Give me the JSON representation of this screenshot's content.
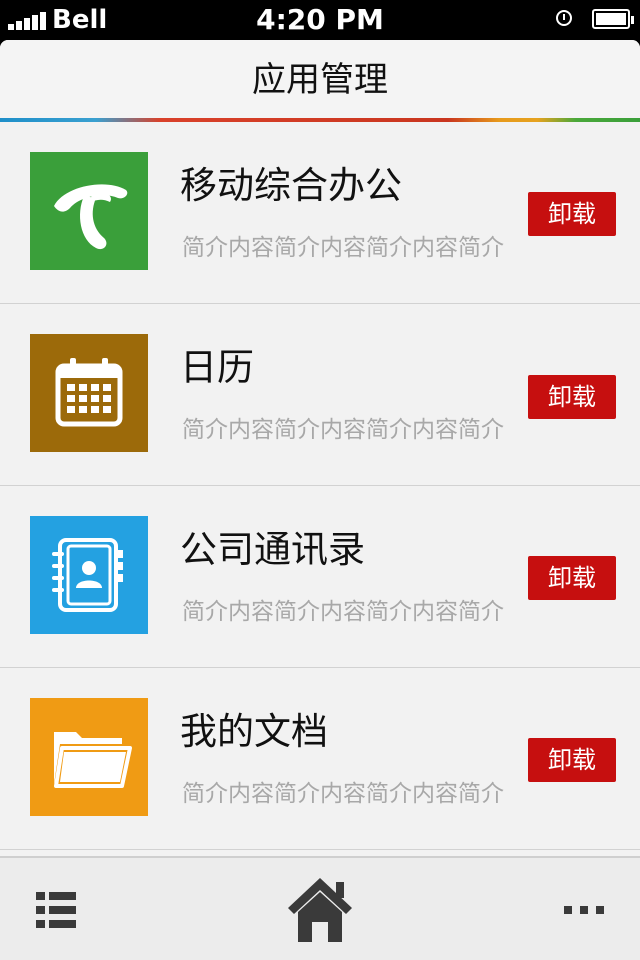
{
  "status_bar": {
    "carrier": "Bell",
    "time": "4:20 PM",
    "icons": [
      "signal-icon",
      "alarm-icon",
      "battery-icon"
    ]
  },
  "header": {
    "title": "应用管理"
  },
  "apps": [
    {
      "name": "移动综合办公",
      "description": "简介内容简介内容简介内容简介",
      "button_label": "卸载",
      "icon": "telecom-logo-icon",
      "icon_color": "#3a9f3a"
    },
    {
      "name": "日历",
      "description": "简介内容简介内容简介内容简介",
      "button_label": "卸载",
      "icon": "calendar-icon",
      "icon_color": "#9c6a0a"
    },
    {
      "name": "公司通讯录",
      "description": "简介内容简介内容简介内容简介",
      "button_label": "卸载",
      "icon": "address-book-icon",
      "icon_color": "#24a1e1"
    },
    {
      "name": "我的文档",
      "description": "简介内容简介内容简介内容简介",
      "button_label": "卸载",
      "icon": "folder-icon",
      "icon_color": "#f09b14"
    }
  ],
  "tab_bar": {
    "items": [
      "list-icon",
      "home-icon",
      "more-icon"
    ]
  },
  "colors": {
    "button": "#c60f0f",
    "title_text": "#111111",
    "description_text": "#a8a8a8",
    "background": "#f2f2f2"
  }
}
